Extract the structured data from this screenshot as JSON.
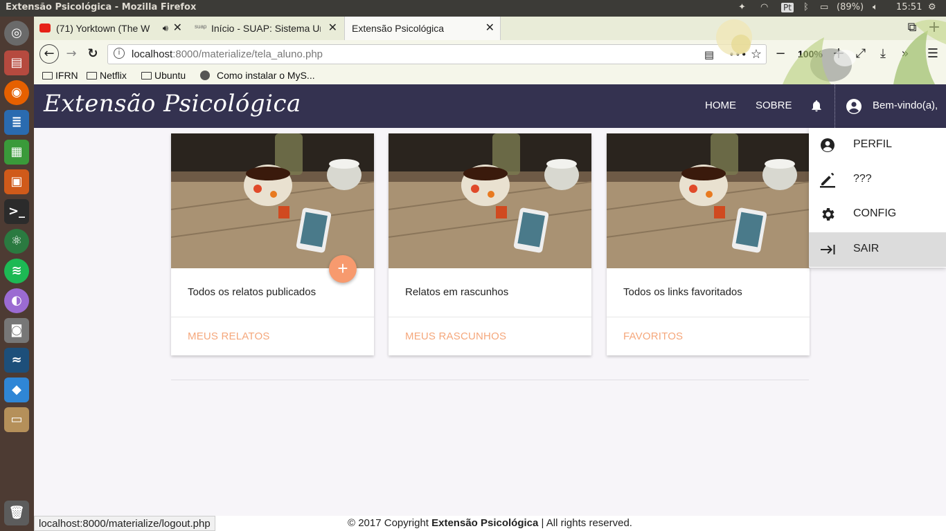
{
  "os": {
    "window_title": "Extensão Psicológica - Mozilla Firefox",
    "battery": "(89%)",
    "clock": "15:51",
    "keyboard": "Pt"
  },
  "browser": {
    "tabs": [
      {
        "title": "(71) Yorktown (The W",
        "icon": "youtube-icon"
      },
      {
        "title": "Início - SUAP: Sistema Un",
        "icon": "suap-icon",
        "icon_text": "suap"
      },
      {
        "title": "Extensão Psicológica",
        "icon": "none"
      }
    ],
    "url_host": "localhost",
    "url_rest": ":8000/materialize/tela_aluno.php",
    "zoom": "100%",
    "bookmarks": [
      "IFRN",
      "Netflix",
      "Ubuntu",
      "Como instalar o MyS..."
    ],
    "status_url": "localhost:8000/materialize/logout.php"
  },
  "app": {
    "brand": "Extensão Psicológica",
    "nav": {
      "home": "HOME",
      "about": "SOBRE",
      "welcome": "Bem-vindo(a),"
    },
    "cards": [
      {
        "desc": "Todos os relatos publicados",
        "action": "MEUS RELATOS"
      },
      {
        "desc": "Relatos em rascunhos",
        "action": "MEUS RASCUNHOS"
      },
      {
        "desc": "Todos os links favoritados",
        "action": "FAVORITOS"
      }
    ],
    "fab_label": "+",
    "dropdown": [
      {
        "label": "PERFIL",
        "icon": "account-circle-icon"
      },
      {
        "label": "???",
        "icon": "edit-icon"
      },
      {
        "label": "CONFIG",
        "icon": "settings-icon"
      },
      {
        "label": "SAIR",
        "icon": "logout-icon"
      }
    ],
    "footer": {
      "prefix": "© 2017 Copyright ",
      "brand": "Extensão Psicológica",
      "suffix": " | All rights reserved."
    }
  },
  "colors": {
    "navbar": "#343250",
    "accent": "#f79a6e",
    "action_text": "#f5a77b"
  }
}
